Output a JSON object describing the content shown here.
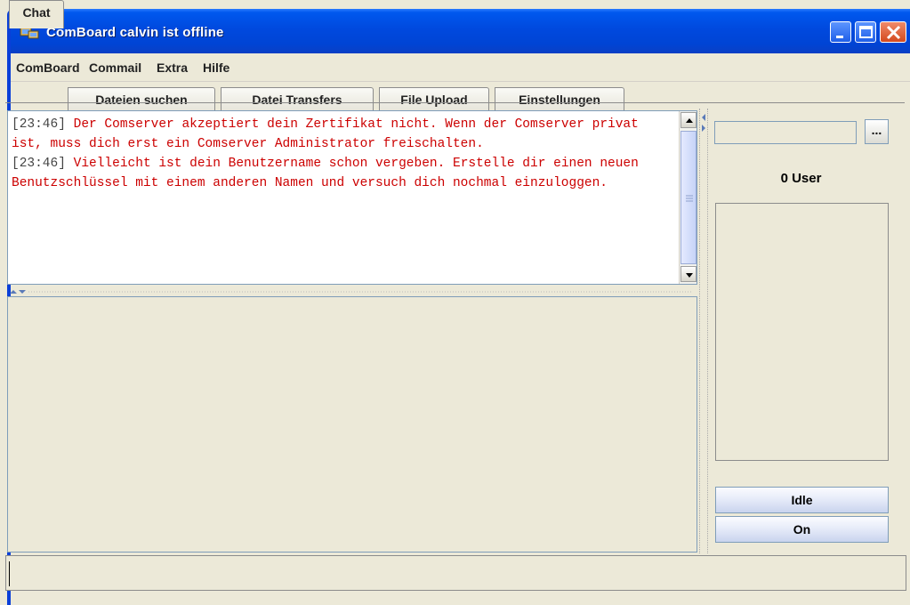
{
  "window": {
    "title": "ComBoard calvin ist offline",
    "title_color": "#0049de"
  },
  "menubar": {
    "items": [
      "ComBoard",
      "Commail",
      "Extra",
      "Hilfe"
    ]
  },
  "tabs": [
    {
      "label": "Chat",
      "active": true
    },
    {
      "label": "Dateien suchen",
      "active": false
    },
    {
      "label": "Datei Transfers",
      "active": false
    },
    {
      "label": "File Upload",
      "active": false
    },
    {
      "label": "Einstellungen",
      "active": false
    }
  ],
  "chat": {
    "messages": [
      {
        "timestamp": "[23:46]",
        "text": "Der Comserver akzeptiert dein Zertifikat nicht. Wenn der Comserver privat ist, muss dich erst ein Comserver Administrator freischalten."
      },
      {
        "timestamp": "[23:46]",
        "text": "Vielleicht ist dein Benutzername schon vergeben. Erstelle dir einen neuen Benutzschlüssel mit einem anderen Namen und versuch dich nochmal einzuloggen."
      }
    ],
    "message_color": "#cc0000"
  },
  "sidebar": {
    "server_field_value": "",
    "browse_label": "...",
    "user_count": "0 User",
    "idle_button": "Idle",
    "on_button": "On"
  },
  "statusbar": {
    "input_value": ""
  }
}
